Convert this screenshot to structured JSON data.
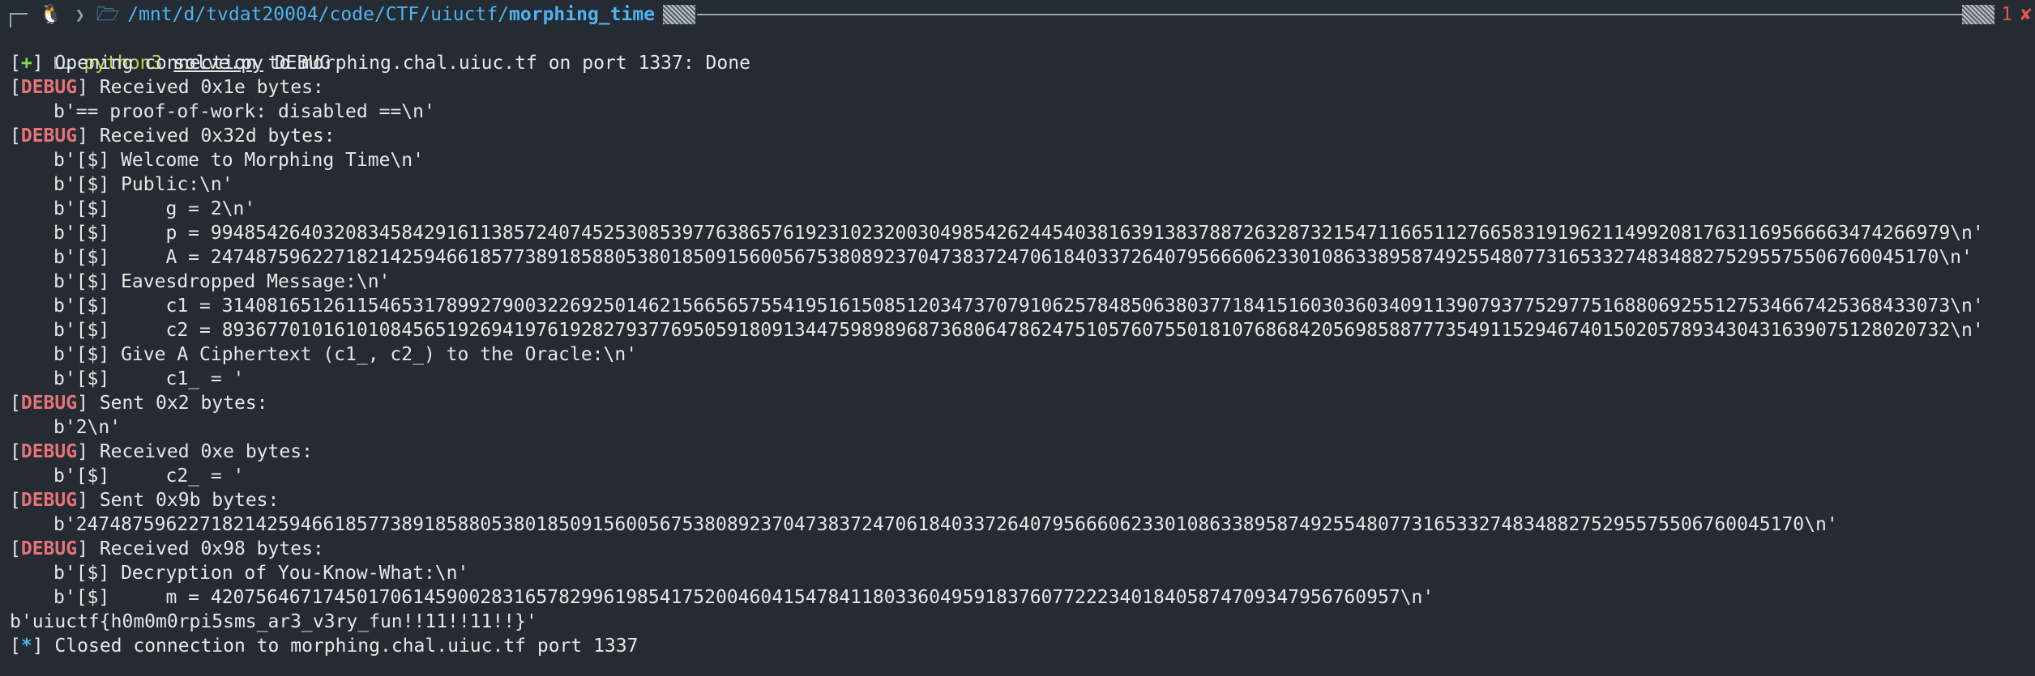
{
  "prompt": {
    "path_prefix": "/mnt/d/tvdat20004/code/CTF/uiuctf/",
    "path_current": "morphing_time",
    "exit_code": "1",
    "exit_mark": "✘",
    "command": {
      "program": "python3",
      "script": "solve.py",
      "argument": "DEBUG"
    }
  },
  "icons": {
    "os": "tux-icon",
    "separator": "chevron-right-icon",
    "folder": "folder-icon",
    "error": "cross-icon"
  },
  "colors": {
    "background": "#242b33",
    "debug_tag": "#e8727a",
    "plus_tag": "#8bd34a",
    "star_tag": "#4fb3ef",
    "path": "#4fb3ef",
    "python_cmd": "#b8d45a",
    "error": "#e8524f"
  },
  "output": [
    {
      "tag": "+",
      "tag_type": "plus",
      "text": " Opening connection to morphing.chal.uiuc.tf on port 1337: Done",
      "indent": false
    },
    {
      "tag": "DEBUG",
      "tag_type": "debug",
      "text": " Received 0x1e bytes:",
      "indent": false
    },
    {
      "tag": "",
      "tag_type": "none",
      "text": "b'== proof-of-work: disabled ==\\n'",
      "indent": true
    },
    {
      "tag": "DEBUG",
      "tag_type": "debug",
      "text": " Received 0x32d bytes:",
      "indent": false
    },
    {
      "tag": "",
      "tag_type": "none",
      "text": "b'[$] Welcome to Morphing Time\\n'",
      "indent": true
    },
    {
      "tag": "",
      "tag_type": "none",
      "text": "b'[$] Public:\\n'",
      "indent": true
    },
    {
      "tag": "",
      "tag_type": "none",
      "text": "b'[$]     g = 2\\n'",
      "indent": true
    },
    {
      "tag": "",
      "tag_type": "none",
      "text": "b'[$]     p = 99485426403208345842916113857240745253085397763865761923102320030498542624454038163913837887263287321547116651127665831919621149920817631169566663474266979\\n'",
      "indent": true
    },
    {
      "tag": "",
      "tag_type": "none",
      "text": "b'[$]     A = 24748759622718214259466185773891858805380185091560056753808923704738372470618403372640795666062330108633895874925548077316533274834882752955755067600451​70\\n'",
      "indent": true
    },
    {
      "tag": "",
      "tag_type": "none",
      "text": "b'[$] Eavesdropped Message:\\n'",
      "indent": true
    },
    {
      "tag": "",
      "tag_type": "none",
      "text": "b'[$]     c1 = 31408165126115465317899279003226925014621566565755419516150851203473707910625784850638037718415160303603409113907937752977516880692551275346674253684330​73\\n'",
      "indent": true
    },
    {
      "tag": "",
      "tag_type": "none",
      "text": "b'[$]     c2 = 89367701016101084565192694197619282793776950591809134475989896873680647862475105760755018107686842056985887773549115294674015020578934304316390751280207​32\\n'",
      "indent": true
    },
    {
      "tag": "",
      "tag_type": "none",
      "text": "b'[$] Give A Ciphertext (c1_, c2_) to the Oracle:\\n'",
      "indent": true
    },
    {
      "tag": "",
      "tag_type": "none",
      "text": "b'[$]     c1_ = '",
      "indent": true
    },
    {
      "tag": "DEBUG",
      "tag_type": "debug",
      "text": " Sent 0x2 bytes:",
      "indent": false
    },
    {
      "tag": "",
      "tag_type": "none",
      "text": "b'2\\n'",
      "indent": true
    },
    {
      "tag": "DEBUG",
      "tag_type": "debug",
      "text": " Received 0xe bytes:",
      "indent": false
    },
    {
      "tag": "",
      "tag_type": "none",
      "text": "b'[$]     c2_ = '",
      "indent": true
    },
    {
      "tag": "DEBUG",
      "tag_type": "debug",
      "text": " Sent 0x9b bytes:",
      "indent": false
    },
    {
      "tag": "",
      "tag_type": "none",
      "text": "b'24748759622718214259466185773891858805380185091560056753808923704738372470618403372640795666062330108633895874925548077316533274834882752955755067600451​70\\n'",
      "indent": true
    },
    {
      "tag": "DEBUG",
      "tag_type": "debug",
      "text": " Received 0x98 bytes:",
      "indent": false
    },
    {
      "tag": "",
      "tag_type": "none",
      "text": "b'[$] Decryption of You-Know-What:\\n'",
      "indent": true
    },
    {
      "tag": "",
      "tag_type": "none",
      "text": "b'[$]     m = 420756467174501706145900283165782996198541752004604154784118033604959183760772223401840587470934795676095​7\\n'",
      "indent": true
    },
    {
      "tag": "",
      "tag_type": "none",
      "text": "b'uiuctf{h0m0m0rpi5sms_ar3_v3ry_fun!!11!!11!!}'",
      "indent": false
    },
    {
      "tag": "*",
      "tag_type": "star",
      "text": " Closed connection to morphing.chal.uiuc.tf port 1337",
      "indent": false
    }
  ]
}
